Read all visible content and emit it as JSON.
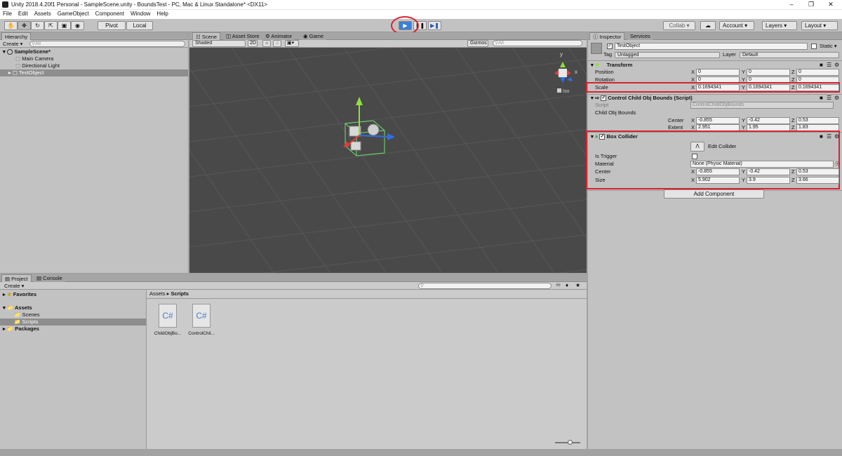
{
  "window": {
    "title": "Unity 2018.4.20f1 Personal - SampleScene.unity - BoundsTest - PC, Mac & Linux Standalone* <DX11>"
  },
  "menu": [
    "File",
    "Edit",
    "Assets",
    "GameObject",
    "Component",
    "Window",
    "Help"
  ],
  "toolbar": {
    "pivot": "Pivot",
    "local": "Local",
    "collab": "Collab",
    "account": "Account",
    "layers": "Layers",
    "layout": "Layout"
  },
  "hierarchy": {
    "tab": "Hierarchy",
    "create": "Create",
    "search": "All",
    "scene": "SampleScene*",
    "items": [
      "Main Camera",
      "Directional Light",
      "TestObject"
    ]
  },
  "scene_view": {
    "tabs": [
      "Scene",
      "Asset Store",
      "Animator",
      "Game"
    ],
    "shading": "Shaded",
    "mode2d": "2D",
    "gizmos": "Gizmos",
    "search": "All",
    "axis_y": "y",
    "axis_x": "x",
    "iso": "Iso"
  },
  "project": {
    "tabs": [
      "Project",
      "Console"
    ],
    "create": "Create",
    "tree": {
      "favorites": "Favorites",
      "assets": "Assets",
      "scenes": "Scenes",
      "scripts": "Scripts",
      "packages": "Packages"
    },
    "breadcrumb": {
      "root": "Assets",
      "current": "Scripts"
    },
    "files": [
      {
        "name": "ChildObjBo...",
        "badge": "C#"
      },
      {
        "name": "ControlChil...",
        "badge": "C#"
      }
    ]
  },
  "inspector": {
    "tabs": [
      "Inspector",
      "Services"
    ],
    "object_name": "TestObject",
    "static": "Static",
    "tag_label": "Tag",
    "tag": "Untagged",
    "layer_label": "Layer",
    "layer": "Default",
    "transform": {
      "title": "Transform",
      "position": {
        "label": "Position",
        "x": "0",
        "y": "0",
        "z": "0"
      },
      "rotation": {
        "label": "Rotation",
        "x": "0",
        "y": "0",
        "z": "0"
      },
      "scale": {
        "label": "Scale",
        "x": "0.1694341",
        "y": "0.1694341",
        "z": "0.1694341"
      }
    },
    "script_component": {
      "title": "Control Child Obj Bounds (Script)",
      "script_label": "Script",
      "script_value": "ControlChildObjBounds",
      "bounds_label": "Child Obj Bounds",
      "center": {
        "label": "Center",
        "x": "-0.855",
        "y": "-0.42",
        "z": "0.53"
      },
      "extent": {
        "label": "Extent",
        "x": "2.951",
        "y": "1.95",
        "z": "1.83"
      }
    },
    "box_collider": {
      "title": "Box Collider",
      "edit": "Edit Collider",
      "is_trigger": "Is Trigger",
      "material_label": "Material",
      "material_value": "None (Physic Material)",
      "center": {
        "label": "Center",
        "x": "-0.855",
        "y": "-0.42",
        "z": "0.53"
      },
      "size": {
        "label": "Size",
        "x": "5.902",
        "y": "3.9",
        "z": "3.66"
      }
    },
    "add_component": "Add Component"
  },
  "axis_letters": {
    "x": "X",
    "y": "Y",
    "z": "Z"
  },
  "colors": {
    "highlight": "#d7232f",
    "play_blue": "#3d7fd6",
    "scene_bg": "#494949",
    "panel": "#c2c2c2"
  }
}
